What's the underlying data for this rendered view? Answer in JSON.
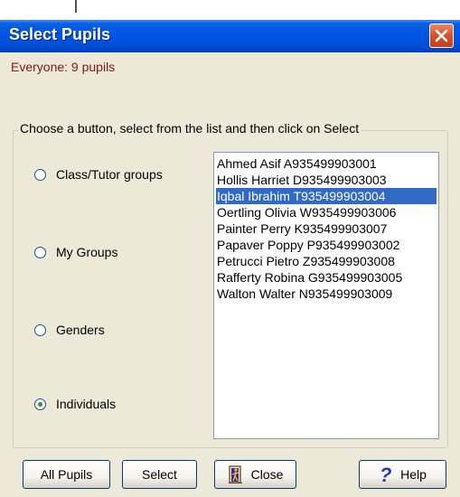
{
  "window": {
    "title": "Select Pupils"
  },
  "status": {
    "text": "Everyone: 9 pupils",
    "color": "#8b1414"
  },
  "groupbox": {
    "legend": "Choose a button, select from the list and then click on Select"
  },
  "options": [
    {
      "label": "Class/Tutor groups",
      "checked": false
    },
    {
      "label": "My Groups",
      "checked": false
    },
    {
      "label": "Genders",
      "checked": false
    },
    {
      "label": "Individuals",
      "checked": true
    }
  ],
  "pupils": [
    {
      "label": "Ahmed Asif A935499903001",
      "selected": false
    },
    {
      "label": "Hollis Harriet D935499903003",
      "selected": false
    },
    {
      "label": "Iqbal Ibrahim T935499903004",
      "selected": true
    },
    {
      "label": "Oertling Olivia W935499903006",
      "selected": false
    },
    {
      "label": "Painter Perry K935499903007",
      "selected": false
    },
    {
      "label": "Papaver Poppy P935499903002",
      "selected": false
    },
    {
      "label": "Petrucci Pietro Z935499903008",
      "selected": false
    },
    {
      "label": "Rafferty Robina G935499903005",
      "selected": false
    },
    {
      "label": "Walton Walter N935499903009",
      "selected": false
    }
  ],
  "buttons": {
    "all_pupils": "All Pupils",
    "select": "Select",
    "close": "Close",
    "help": "Help"
  },
  "icons": {
    "close_window": "close-x-icon",
    "close_button": "door-exit-icon",
    "help_button": "question-mark-icon"
  },
  "colors": {
    "titlebar": "#0055e5",
    "selection": "#316ac5",
    "radio_dot": "#21a121",
    "help_icon": "#1b3fb3"
  }
}
